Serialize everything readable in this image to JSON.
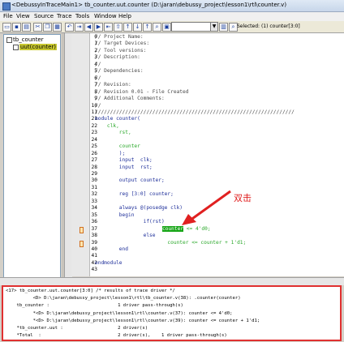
{
  "window": {
    "title": "<DebussyInTraceMain1> tb_counter.uut.counter (D:\\jaran\\debussy_project\\lesson1\\rtl\\counter.v)"
  },
  "menu": [
    "File",
    "View",
    "Source",
    "Trace",
    "Tools",
    "Window",
    "Help"
  ],
  "toolbar": {
    "selected_label": "Selected: (1) counter[3:0]",
    "icons": [
      "open-icon",
      "save-icon",
      "print-icon",
      "cut-icon",
      "copy-icon",
      "paste-icon",
      "undo-icon",
      "search-icon",
      "driver-icon",
      "load-icon",
      "back-icon",
      "forward-icon",
      "up-icon",
      "down-icon",
      "trace-icon",
      "step-icon",
      "list-icon",
      "clip-icon"
    ]
  },
  "tree": {
    "root": "tb_counter",
    "child": "uut(counter)"
  },
  "code": {
    "lines": [
      {
        "n": "0",
        "t": "// Project Name:",
        "c": "cm"
      },
      {
        "n": "1",
        "t": "// Target Devices:",
        "c": "cm"
      },
      {
        "n": "2",
        "t": "// Tool versions:",
        "c": "cm"
      },
      {
        "n": "3",
        "t": "// Description:",
        "c": "cm"
      },
      {
        "n": "4",
        "t": "//",
        "c": "cm"
      },
      {
        "n": "5",
        "t": "// Dependencies:",
        "c": "cm"
      },
      {
        "n": "6",
        "t": "//",
        "c": "cm"
      },
      {
        "n": "7",
        "t": "// Revision:",
        "c": "cm"
      },
      {
        "n": "8",
        "t": "// Revision 0.01 - File Created",
        "c": "cm"
      },
      {
        "n": "9",
        "t": "// Additional Comments:",
        "c": "cm"
      },
      {
        "n": "10",
        "t": "//",
        "c": "cm"
      },
      {
        "n": "11",
        "t": "//////////////////////////////////////////////////////////////////",
        "c": "cm"
      },
      {
        "n": "21",
        "t": "module counter(",
        "c": "kw"
      },
      {
        "n": "22",
        "t": "    clk,",
        "c": "dc"
      },
      {
        "n": "23",
        "t": "        rst,",
        "c": "dc"
      },
      {
        "n": "24",
        "t": "",
        "c": ""
      },
      {
        "n": "25",
        "t": "        counter",
        "c": "dc"
      },
      {
        "n": "26",
        "t": "        );",
        "c": "kw"
      },
      {
        "n": "27",
        "t": "        input  clk;",
        "c": "kw"
      },
      {
        "n": "28",
        "t": "        input  rst;",
        "c": "kw"
      },
      {
        "n": "29",
        "t": "",
        "c": ""
      },
      {
        "n": "30",
        "t": "        output counter;",
        "c": "kw"
      },
      {
        "n": "31",
        "t": "",
        "c": ""
      },
      {
        "n": "32",
        "t": "        reg [3:0] counter;",
        "c": "kw"
      },
      {
        "n": "33",
        "t": "",
        "c": ""
      },
      {
        "n": "34",
        "t": "        always @(posedge clk)",
        "c": "kw"
      },
      {
        "n": "35",
        "t": "        begin",
        "c": "kw"
      },
      {
        "n": "36",
        "t": "                if(rst)",
        "c": "kw"
      },
      {
        "n": "37",
        "t": "",
        "c": "",
        "hl": "counter",
        "rest": " <= 4'd0;"
      },
      {
        "n": "38",
        "t": "                else",
        "c": "kw"
      },
      {
        "n": "39",
        "t": "                        counter <= counter + 1'd1;",
        "c": "dc"
      },
      {
        "n": "40",
        "t": "        end",
        "c": "kw"
      },
      {
        "n": "41",
        "t": "",
        "c": ""
      },
      {
        "n": "42",
        "t": "endmodule",
        "c": "kw"
      },
      {
        "n": "43",
        "t": "",
        "c": ""
      }
    ],
    "annotation": "双击"
  },
  "message": {
    "lines": [
      "<17> tb_counter.uut.counter[3:0] /* results of trace driver */",
      "          <D> D:\\jaran\\debussy_project\\lesson1\\rtl\\tb_counter.v(38): .counter(counter)",
      "    tb_counter :                         1 driver pass-through(s)",
      "          *<D> D:\\jaran\\debussy_project\\lesson1\\rtl\\counter.v(37): counter <= 4'd0;",
      "          *<D> D:\\jaran\\debussy_project\\lesson1\\rtl\\counter.v(39): counter <= counter + 1'd1;",
      "    *tb_counter.uut :                    2 driver(s)",
      "    *Total  :                            2 driver(s),    1 driver pass-through(s)"
    ]
  },
  "colors": {
    "highlight": "#15a515",
    "annotation": "#e02020",
    "border_callout": "#e03030"
  }
}
